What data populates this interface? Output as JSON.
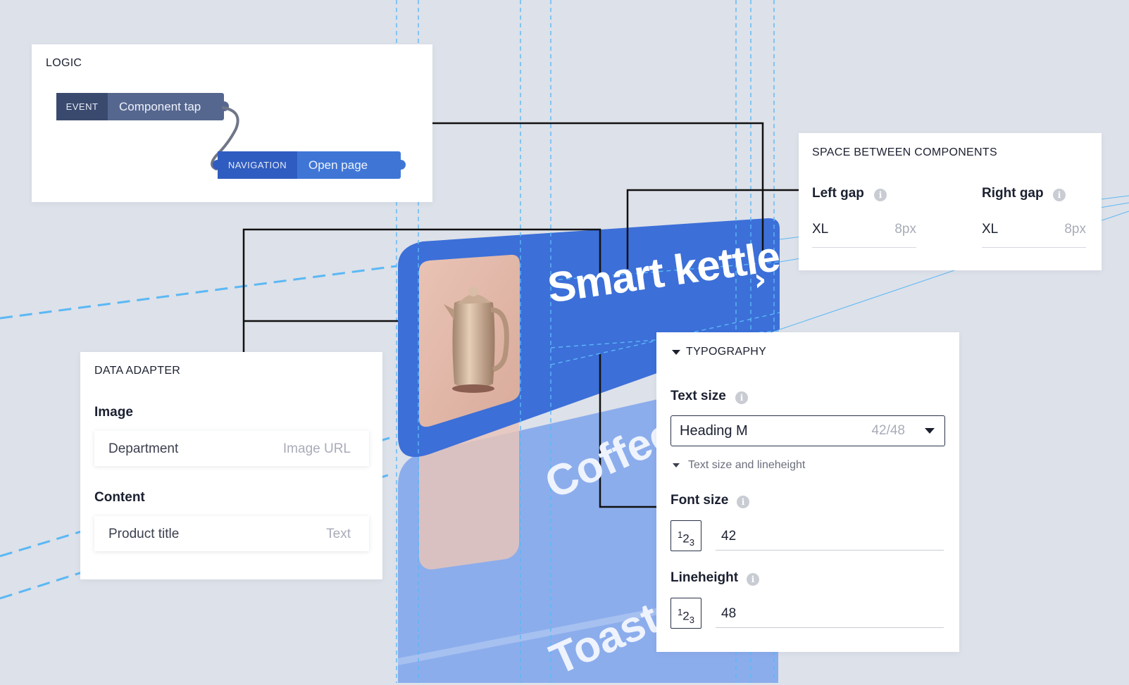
{
  "logic": {
    "title": "LOGIC",
    "event_tag": "EVENT",
    "event_value": "Component tap",
    "nav_tag": "NAVIGATION",
    "nav_value": "Open page"
  },
  "spacing": {
    "title": "SPACE BETWEEN COMPONENTS",
    "left_label": "Left gap",
    "left_value": "XL",
    "left_unit": "8px",
    "right_label": "Right gap",
    "right_value": "XL",
    "right_unit": "8px"
  },
  "data_adapter": {
    "title": "DATA ADAPTER",
    "image_label": "Image",
    "image_value": "Department",
    "image_hint": "Image URL",
    "content_label": "Content",
    "content_value": "Product title",
    "content_hint": "Text"
  },
  "typography": {
    "title": "TYPOGRAPHY",
    "text_size_label": "Text size",
    "text_size_value": "Heading M",
    "text_size_meta": "42/48",
    "sub_label": "Text size and lineheight",
    "font_size_label": "Font size",
    "font_size_value": "42",
    "lineheight_label": "Lineheight",
    "lineheight_value": "48"
  },
  "cards": [
    {
      "title": "Smart kettle"
    },
    {
      "title": "Coffee m"
    },
    {
      "title": "Toaste"
    }
  ],
  "colors": {
    "card_active": "#3c6fd8",
    "card_faded": "#8cadec",
    "event_tag_bg": "#3a4a6f",
    "event_val_bg": "#56678f",
    "nav_tag_bg": "#2f5cc0",
    "nav_val_bg": "#3f76d6",
    "guide": "#5bb8f5"
  },
  "icons": {
    "info": "info-icon",
    "arrow": "chevron-right-icon",
    "number": "number-format-icon",
    "caret": "caret-down-icon"
  }
}
